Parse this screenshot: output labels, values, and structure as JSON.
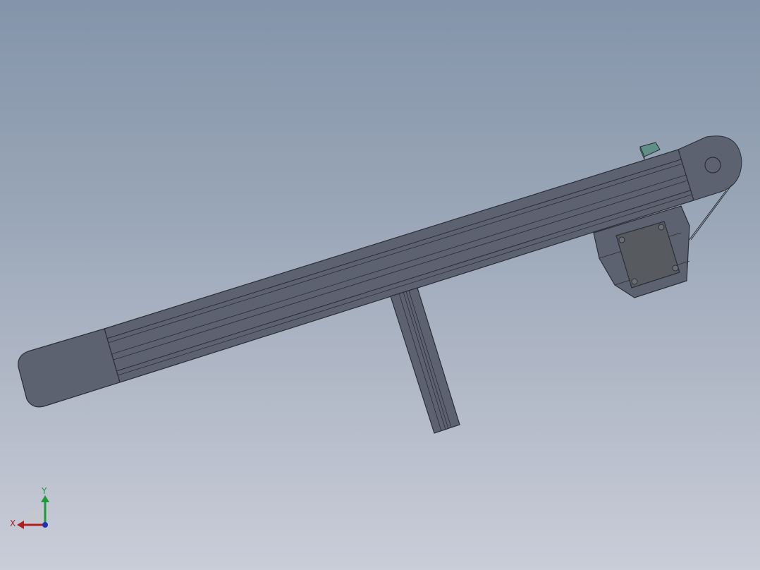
{
  "viewport": {
    "background_top": "#8494aa",
    "background_bottom": "#c9cdd8"
  },
  "model": {
    "name": "belt-conveyor-assembly",
    "body_color": "#5c6270",
    "edge_color": "#2b2e36",
    "accent_color": "#5f8f86"
  },
  "triad": {
    "x_label": "X",
    "y_label": "Y",
    "x_color": "#b02020",
    "y_color": "#1f9a3a",
    "z_color": "#2030b0"
  }
}
